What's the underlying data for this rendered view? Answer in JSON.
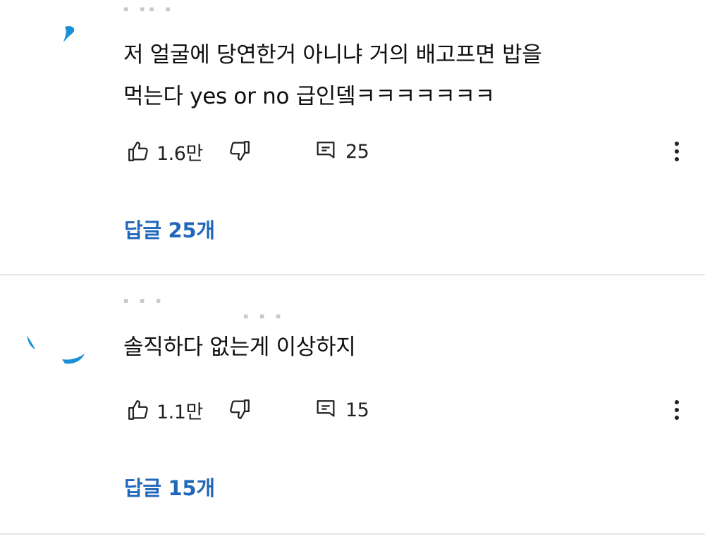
{
  "comments": [
    {
      "author_blur": "▪ ▪▪ ▪",
      "body": "저 얼굴에 당연한거 아니냐 거의 배고프면 밥을\n먹는다 yes or no 급인뎈ㅋㅋㅋㅋㅋㅋㅋ",
      "likes": "1.6만",
      "replies_count": "25",
      "replies_link": "답글 25개"
    },
    {
      "author_blur": "▪ ▪ ▪",
      "author_blur_2": "▪ ▪ ▪",
      "body": "솔직하다 없는게 이상하지",
      "likes": "1.1만",
      "replies_count": "15",
      "replies_link": "답글 15개"
    }
  ],
  "colors": {
    "link": "#2167b9",
    "avatar_accent": "#1a8fd6",
    "divider": "#e6e6e6"
  },
  "icons": {
    "like": "thumbs-up-icon",
    "dislike": "thumbs-down-icon",
    "reply": "reply-icon",
    "more": "more-vert-icon"
  }
}
